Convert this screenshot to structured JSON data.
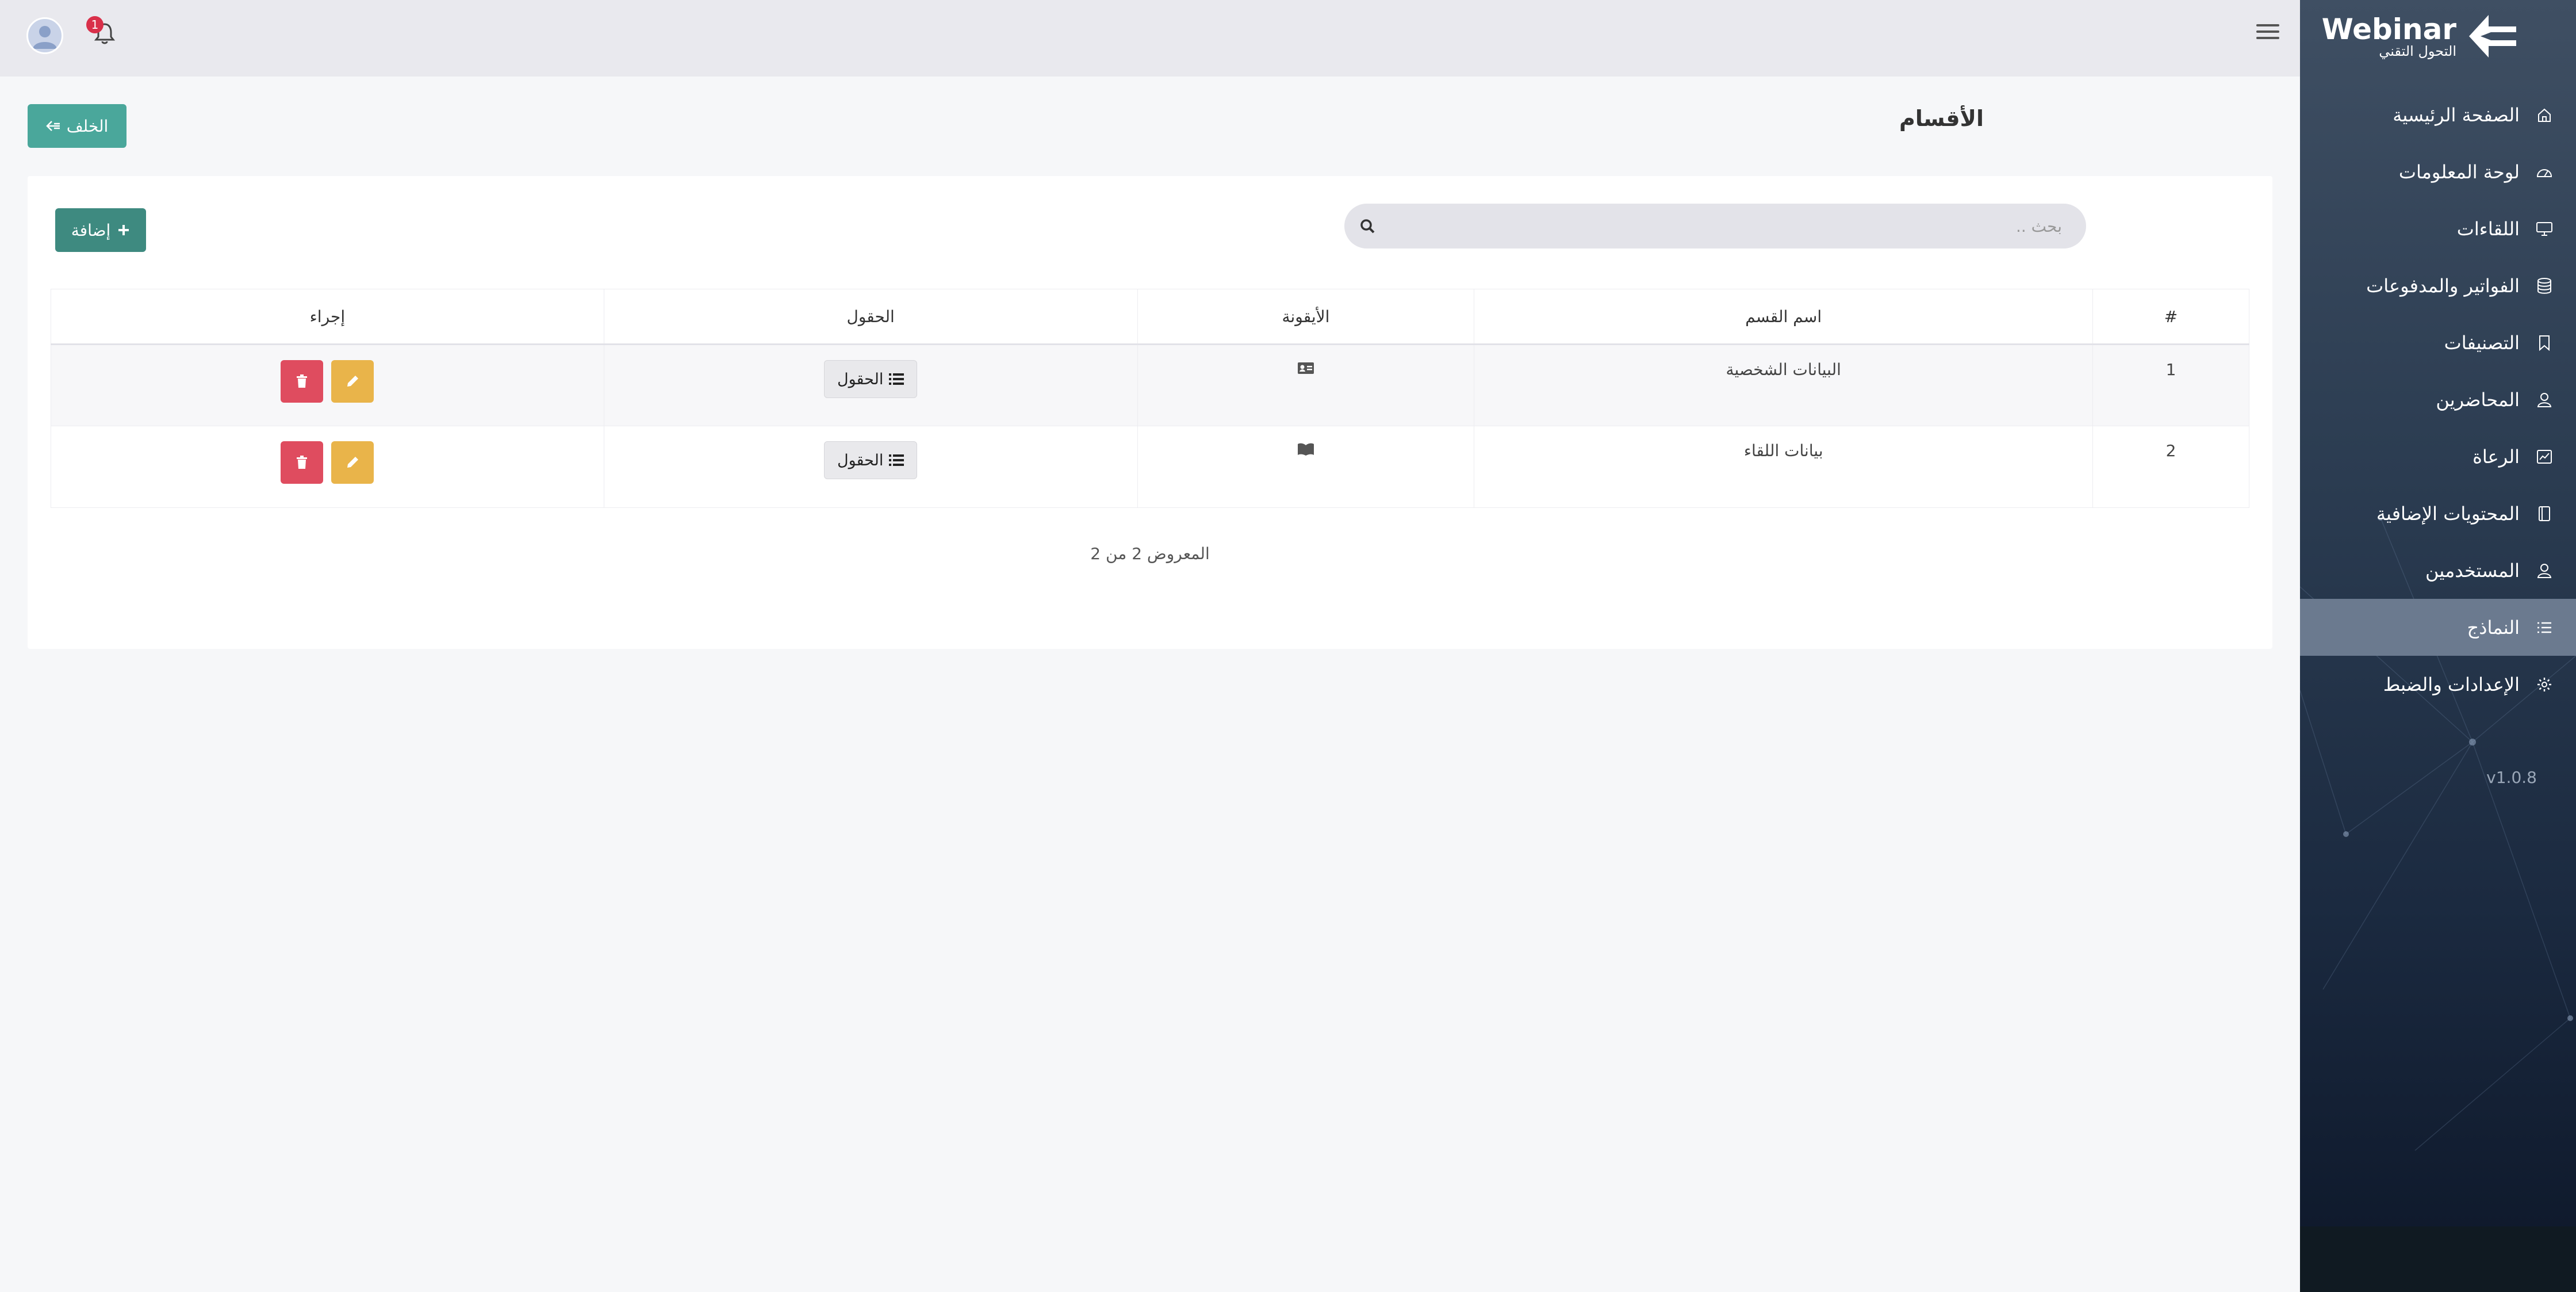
{
  "sidebar": {
    "logo": {
      "brand": "Webinar",
      "tagline": "التحول التقني"
    },
    "items": [
      {
        "label": "الصفحة الرئيسية",
        "icon": "home-icon"
      },
      {
        "label": "لوحة المعلومات",
        "icon": "gauge-icon"
      },
      {
        "label": "اللقاءات",
        "icon": "monitor-icon"
      },
      {
        "label": "الفواتير والمدفوعات",
        "icon": "database-icon"
      },
      {
        "label": "التصنيفات",
        "icon": "bookmark-icon"
      },
      {
        "label": "المحاضرين",
        "icon": "user-icon"
      },
      {
        "label": "الرعاة",
        "icon": "chart-icon"
      },
      {
        "label": "المحتويات الإضافية",
        "icon": "book-icon"
      },
      {
        "label": "المستخدمين",
        "icon": "user-icon"
      },
      {
        "label": "النماذج",
        "icon": "list-icon",
        "active": true
      },
      {
        "label": "الإعدادات والضبط",
        "icon": "gear-icon"
      }
    ],
    "version": "v1.0.8"
  },
  "topbar": {
    "notification_count": "1"
  },
  "page": {
    "title": "الأقسام",
    "back_label": "الخلف"
  },
  "card": {
    "add_label": "إضافة",
    "search_placeholder": "بحث ..",
    "columns": [
      "#",
      "اسم القسم",
      "الأيقونة",
      "الحقول",
      "إجراء"
    ],
    "rows": [
      {
        "num": "1",
        "name": "البيانات الشخصية",
        "icon": "id-card-icon",
        "fields_label": "الحقول"
      },
      {
        "num": "2",
        "name": "بيانات اللقاء",
        "icon": "open-book-icon",
        "fields_label": "الحقول"
      }
    ],
    "summary": "المعروض 2 من 2"
  },
  "colors": {
    "accent_teal": "#4aa79b",
    "add_teal": "#3e8a80",
    "danger": "#df4c5f",
    "warning": "#e9b44a",
    "sidebar_active": "#6b7a8f"
  }
}
